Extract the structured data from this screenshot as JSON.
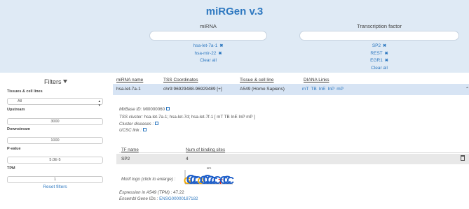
{
  "app": {
    "title": "miRGen v.3"
  },
  "search": {
    "mirna_label": "miRNA",
    "tf_label": "Transcription factor",
    "mirna_tags": [
      "hsa-let-7a-1",
      "hsa-mir-22"
    ],
    "tf_tags": [
      "SP2",
      "REST",
      "EGR1"
    ],
    "remove_glyph": "✖",
    "clear_label": "Clear all"
  },
  "filters": {
    "title": "Filters",
    "tissues_label": "Tissues & cell lines",
    "tissues_value": "All",
    "upstream_label": "Upstream",
    "upstream_value": "3000",
    "downstream_label": "Downstream",
    "downstream_value": "1000",
    "pvalue_label": "P-value",
    "pvalue_value": "5.0E-5",
    "tpm_label": "TPM",
    "tpm_value": "1",
    "reset_label": "Reset filters"
  },
  "table": {
    "headers": [
      "miRNA name",
      "TSS Coordinates",
      "Tissue & cell line",
      "DIANA Links"
    ],
    "row": {
      "name": "hsa-let-7a-1",
      "tss": "chr9:96929488-96929489 [+]",
      "tissue": "A549 (Homo Sapiens)",
      "links": [
        "mT",
        "TB",
        "InE",
        "InP",
        "mP"
      ]
    }
  },
  "detail": {
    "mirbase_label": "MirBase ID:",
    "mirbase_value": "MI0000060",
    "tss_cluster_label": "TSS cluster:",
    "tss_cluster_value": "hsa-let-7a-1; hsa-let-7d; hsa-let-7f-1 [ mT  TB  InE  InP  mP ]",
    "cluster_diseases_label": "Cluster diseases :",
    "ucsc_label": "UCSC link :"
  },
  "tf_table": {
    "headers": [
      "TF name",
      "Num of binding sites"
    ],
    "row": {
      "name": "SP2",
      "count": "4"
    },
    "motif_label": "Motif logo (click to enlarge) :",
    "motif_title": "SP2",
    "motif_seq": "GCCCGCCCCCTCCC"
  },
  "expression": {
    "label": "Expression in A549 (TPM) :",
    "value": "47.22",
    "ensembl_label": "Ensembl Gene IDs :",
    "ensembl_value": "ENSG00000187182"
  },
  "colors": {
    "accent": "#2e78c0",
    "header_bg": "#dfeaf5",
    "row_bg": "#d7e4f4"
  }
}
